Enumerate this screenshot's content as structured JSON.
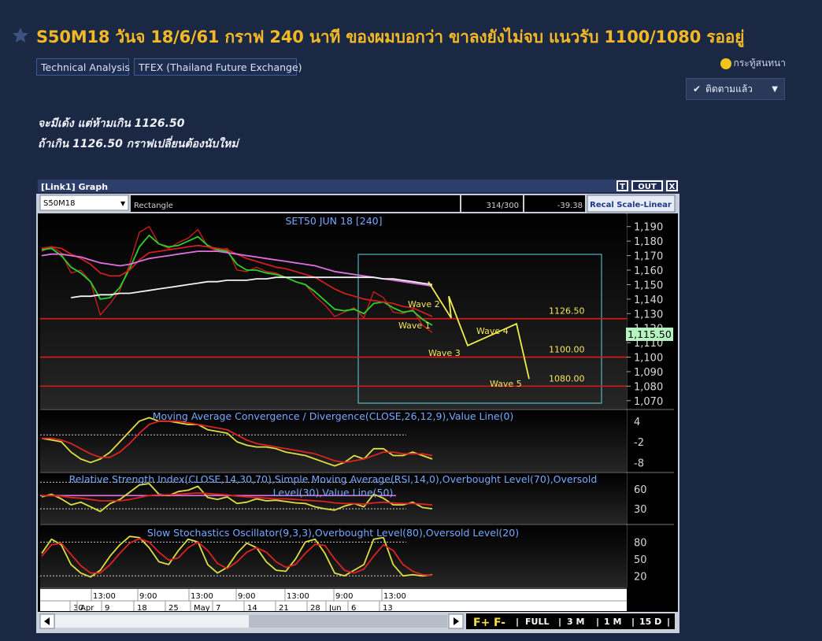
{
  "post": {
    "title": "S50M18 วันจ 18/6/61 กราฟ 240 นาที ของผมบอกว่า ขาลงยังไม่จบ แนวรับ 1100/1080 รออยู่",
    "tags": [
      "Technical Analysis",
      "TFEX (Thailand Future Exchange)"
    ],
    "author": "กระทู้สนทนา",
    "follow_label": "ติดตามแล้ว",
    "lines": [
      "จะมีเด้ง แต่ห้ามเกิน 1126.50",
      "ถ้าเกิน 1126.50 กราฟเปลี่ยนต้องนับใหม่"
    ]
  },
  "chart_window": {
    "title": "[Link1] Graph",
    "buttons": [
      "T",
      "OUT",
      "X"
    ],
    "symbol": "S50M18",
    "tool": "Rectangle",
    "bar_count": "314/300",
    "value": "-39.38",
    "scale_button": "Recal Scale-Linear",
    "bottom_buttons": [
      "F+",
      "F-",
      "FULL",
      "3 M",
      "1 M",
      "15 D"
    ]
  },
  "chart_data": [
    {
      "type": "line",
      "title": "SET50 JUN 18   [240]",
      "ylim": [
        1065,
        1198
      ],
      "y_ticks": [
        "1,190",
        "1,180",
        "1,170",
        "1,160",
        "1,150",
        "1,140",
        "1,130",
        "1,120",
        "1,110",
        "1,100",
        "1,090",
        "1,080",
        "1,070"
      ],
      "last_value": "1,115.50",
      "horizontal_levels": [
        1126.5,
        1100,
        1080
      ],
      "level_labels": [
        "1126.50",
        "1100.00",
        "1080.00"
      ],
      "wave_labels": [
        "Wave 1",
        "Wave 2",
        "Wave 3",
        "Wave 4",
        "Wave 5"
      ],
      "projection": [
        [
          0,
          1152
        ],
        [
          1,
          1127
        ],
        [
          2,
          1142
        ],
        [
          3,
          1108
        ],
        [
          4,
          1123
        ],
        [
          5,
          1085
        ]
      ],
      "series": [
        {
          "color": "#d61e1e",
          "values": [
            1173,
            1176,
            1172,
            1158,
            1160,
            1152,
            1129,
            1137,
            1146,
            1164,
            1186,
            1190,
            1178,
            1175,
            1179,
            1182,
            1188,
            1176,
            1173,
            1175,
            1160,
            1159,
            1162,
            1159,
            1158,
            1155,
            1152,
            1150,
            1142,
            1136,
            1128,
            1131,
            1134,
            1127,
            1145,
            1141,
            1131,
            1130,
            1133,
            1122,
            1117
          ]
        },
        {
          "color": "#27d327",
          "values": [
            1174,
            1175,
            1170,
            1162,
            1158,
            1152,
            1140,
            1141,
            1148,
            1161,
            1176,
            1184,
            1178,
            1176,
            1177,
            1180,
            1183,
            1177,
            1174,
            1173,
            1164,
            1160,
            1160,
            1158,
            1157,
            1155,
            1152,
            1150,
            1145,
            1139,
            1133,
            1132,
            1133,
            1130,
            1137,
            1138,
            1134,
            1131,
            1132,
            1126,
            1122
          ]
        },
        {
          "color": "#cc2020",
          "values": [
            1175,
            1176,
            1175,
            1171,
            1168,
            1164,
            1158,
            1156,
            1156,
            1160,
            1167,
            1172,
            1173,
            1174,
            1175,
            1176,
            1177,
            1176,
            1175,
            1174,
            1171,
            1168,
            1166,
            1164,
            1162,
            1161,
            1159,
            1157,
            1155,
            1151,
            1147,
            1144,
            1142,
            1140,
            1139,
            1138,
            1137,
            1135,
            1134,
            1131,
            1128
          ]
        },
        {
          "color": "#e070e0",
          "values": [
            1170,
            1171,
            1171,
            1170,
            1169,
            1167,
            1165,
            1164,
            1163,
            1164,
            1166,
            1168,
            1169,
            1170,
            1171,
            1172,
            1173,
            1173,
            1173,
            1172,
            1171,
            1170,
            1169,
            1168,
            1167,
            1166,
            1165,
            1164,
            1163,
            1161,
            1159,
            1158,
            1157,
            1156,
            1155,
            1154,
            1153,
            1152,
            1151,
            1150,
            1149
          ]
        },
        {
          "color": "#f2f2f2",
          "values": [
            null,
            null,
            null,
            1141,
            1142,
            1142,
            1143,
            1143,
            1144,
            1144,
            1145,
            1146,
            1147,
            1148,
            1149,
            1150,
            1151,
            1152,
            1152,
            1153,
            1153,
            1153,
            1154,
            1154,
            1155,
            1155,
            1155,
            1155,
            1155,
            1155,
            1155,
            1155,
            1155,
            1155,
            1155,
            1154,
            1154,
            1153,
            1152,
            1151,
            1150
          ]
        }
      ]
    },
    {
      "type": "line",
      "title": "Moving Average Convergence / Divergence(CLOSE,26,12,9),Value Line(0)",
      "y_ticks": [
        "4",
        "-2",
        "-8"
      ],
      "ylim": [
        -10,
        6
      ],
      "series": [
        {
          "color": "#dddd44",
          "values": [
            -1,
            -1.5,
            -2,
            -5,
            -7,
            -8,
            -7,
            -5,
            -2,
            1,
            4,
            5,
            4,
            4,
            3.5,
            3,
            3,
            1.5,
            1,
            0.5,
            -2,
            -3,
            -3.5,
            -3.5,
            -4,
            -5,
            -5.5,
            -6,
            -7,
            -8,
            -9,
            -8,
            -6,
            -7,
            -4,
            -4,
            -6,
            -6,
            -5,
            -6,
            -7
          ]
        },
        {
          "color": "#dd2222",
          "values": [
            -1,
            -1,
            -1.5,
            -2.5,
            -4,
            -5.5,
            -6.5,
            -6.5,
            -5,
            -2.5,
            0.5,
            3,
            4,
            4,
            4,
            3.5,
            3,
            2.5,
            2,
            1.5,
            0,
            -1.5,
            -2.5,
            -3,
            -3.5,
            -4,
            -4.5,
            -5,
            -5.5,
            -6.5,
            -7.5,
            -8,
            -7.5,
            -7,
            -6,
            -5,
            -5,
            -5.5,
            -5.5,
            -5.5,
            -6
          ]
        }
      ]
    },
    {
      "type": "line",
      "title": "Relative Strength Index(CLOSE,14,30,70),Simple Moving Average(RSI,14,0),Overbought Level(70),Oversold Level(30),Value Line(50)",
      "y_ticks": [
        "60",
        "30"
      ],
      "ylim": [
        10,
        80
      ],
      "series": [
        {
          "color": "#dddd44",
          "values": [
            48,
            52,
            45,
            36,
            40,
            33,
            26,
            38,
            44,
            55,
            66,
            68,
            52,
            50,
            56,
            58,
            64,
            47,
            44,
            48,
            38,
            40,
            45,
            42,
            43,
            41,
            39,
            38,
            33,
            30,
            28,
            34,
            38,
            33,
            52,
            46,
            36,
            36,
            40,
            32,
            30
          ]
        },
        {
          "color": "#dd2222",
          "values": [
            50,
            50,
            49,
            47,
            46,
            44,
            42,
            42,
            42,
            44,
            47,
            50,
            51,
            51,
            52,
            53,
            54,
            53,
            52,
            51,
            49,
            48,
            47,
            46,
            45,
            45,
            44,
            43,
            42,
            41,
            39,
            38,
            38,
            37,
            39,
            40,
            39,
            38,
            38,
            37,
            36
          ]
        }
      ]
    },
    {
      "type": "line",
      "title": "Slow Stochastics Oscillator(9,3,3),Overbought Level(80),Oversold Level(20)",
      "y_ticks": [
        "80",
        "50",
        "20"
      ],
      "ylim": [
        5,
        100
      ],
      "series": [
        {
          "color": "#dddd44",
          "values": [
            60,
            85,
            75,
            40,
            25,
            18,
            30,
            55,
            75,
            90,
            88,
            70,
            45,
            40,
            65,
            85,
            80,
            40,
            25,
            35,
            60,
            78,
            70,
            45,
            30,
            28,
            50,
            80,
            85,
            60,
            25,
            20,
            30,
            40,
            85,
            88,
            40,
            20,
            22,
            20,
            22
          ]
        },
        {
          "color": "#dd2222",
          "values": [
            55,
            75,
            78,
            58,
            38,
            25,
            25,
            40,
            60,
            78,
            86,
            80,
            62,
            48,
            52,
            70,
            80,
            65,
            42,
            33,
            45,
            62,
            70,
            62,
            45,
            35,
            40,
            60,
            76,
            74,
            50,
            30,
            25,
            32,
            55,
            75,
            65,
            40,
            28,
            22,
            21
          ]
        }
      ]
    }
  ],
  "time_axis": {
    "times": [
      "13:00",
      "9:00",
      "13:00",
      "9:00",
      "13:00",
      "9:00",
      "13:00"
    ],
    "dates": [
      "30",
      "Apr",
      "9",
      "18",
      "25",
      "May",
      "7",
      "14",
      "21",
      "28",
      "Jun",
      "6",
      "13"
    ]
  }
}
